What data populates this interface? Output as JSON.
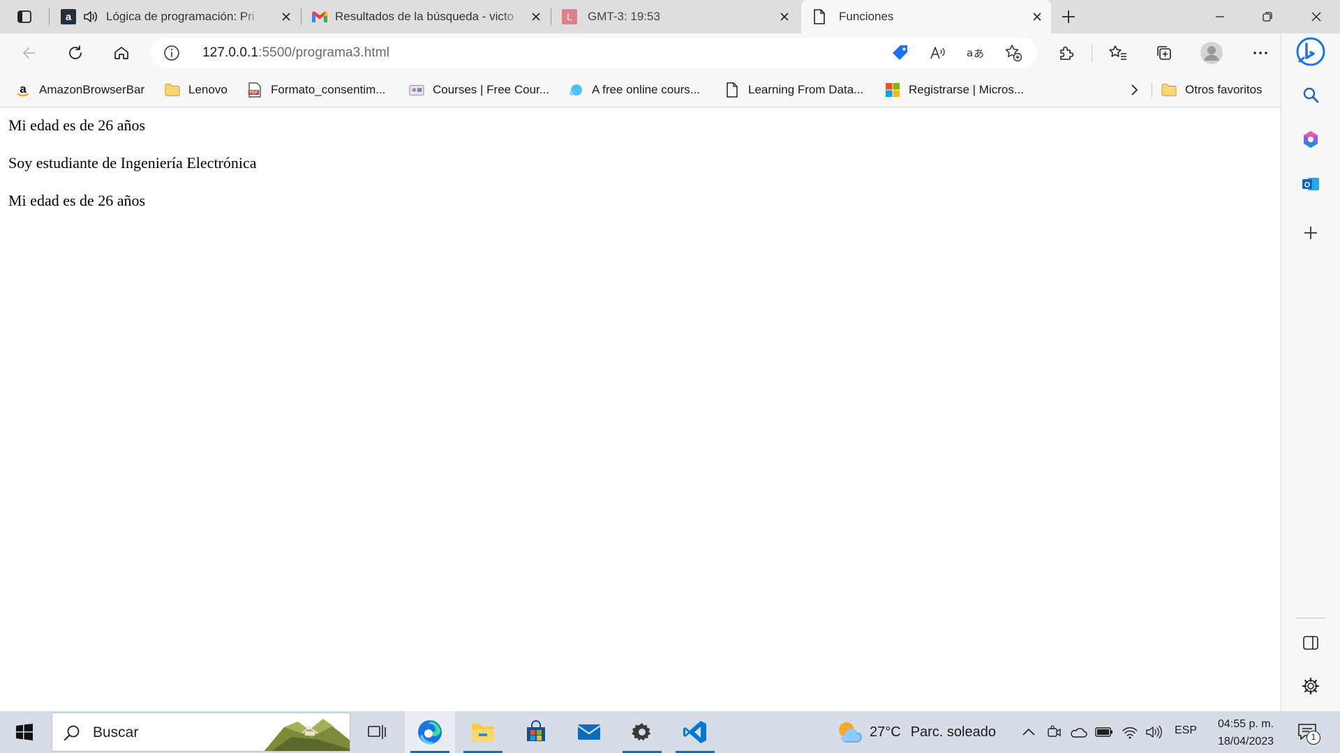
{
  "browser": {
    "tabs": [
      {
        "title": "Lógica de programación: Pri",
        "favicon": "amazon-a-icon",
        "audio": true,
        "active": false
      },
      {
        "title": "Resultados de la búsqueda - victo",
        "favicon": "gmail-icon",
        "active": false
      },
      {
        "title": "GMT-3: 19:53",
        "favicon": "l-tile-icon",
        "active": false
      },
      {
        "title": "Funciones",
        "favicon": "page-icon",
        "active": true
      }
    ],
    "address": {
      "host": "127.0.0.1",
      "path": ":5500/programa3.html"
    },
    "favorites": [
      {
        "label": "AmazonBrowserBar",
        "icon": "amazon-icon"
      },
      {
        "label": "Lenovo",
        "icon": "folder-icon"
      },
      {
        "label": "Formato_consentim...",
        "icon": "pdf-icon"
      },
      {
        "label": "Courses | Free Cour...",
        "icon": "courses-icon"
      },
      {
        "label": "A free online cours...",
        "icon": "bubble-icon"
      },
      {
        "label": "Learning From Data...",
        "icon": "page-icon"
      },
      {
        "label": "Registrarse | Micros...",
        "icon": "microsoft-icon"
      }
    ],
    "other_favorites": "Otros favoritos"
  },
  "page": {
    "lines": [
      "Mi edad es de 26 años",
      "Soy estudiante de Ingeniería Electrónica",
      "Mi edad es de 26 años"
    ]
  },
  "taskbar": {
    "search_label": "Buscar",
    "weather_temp": "27°C",
    "weather_desc": "Parc. soleado",
    "language": "ESP",
    "time": "04:55 p. m.",
    "date": "18/04/2023",
    "notifications": "1"
  },
  "colors": {
    "accent": "#0f6cbd",
    "tabstrip": "#dedede",
    "toolbar": "#f7f7f7",
    "taskbar": "#d6dde7"
  }
}
